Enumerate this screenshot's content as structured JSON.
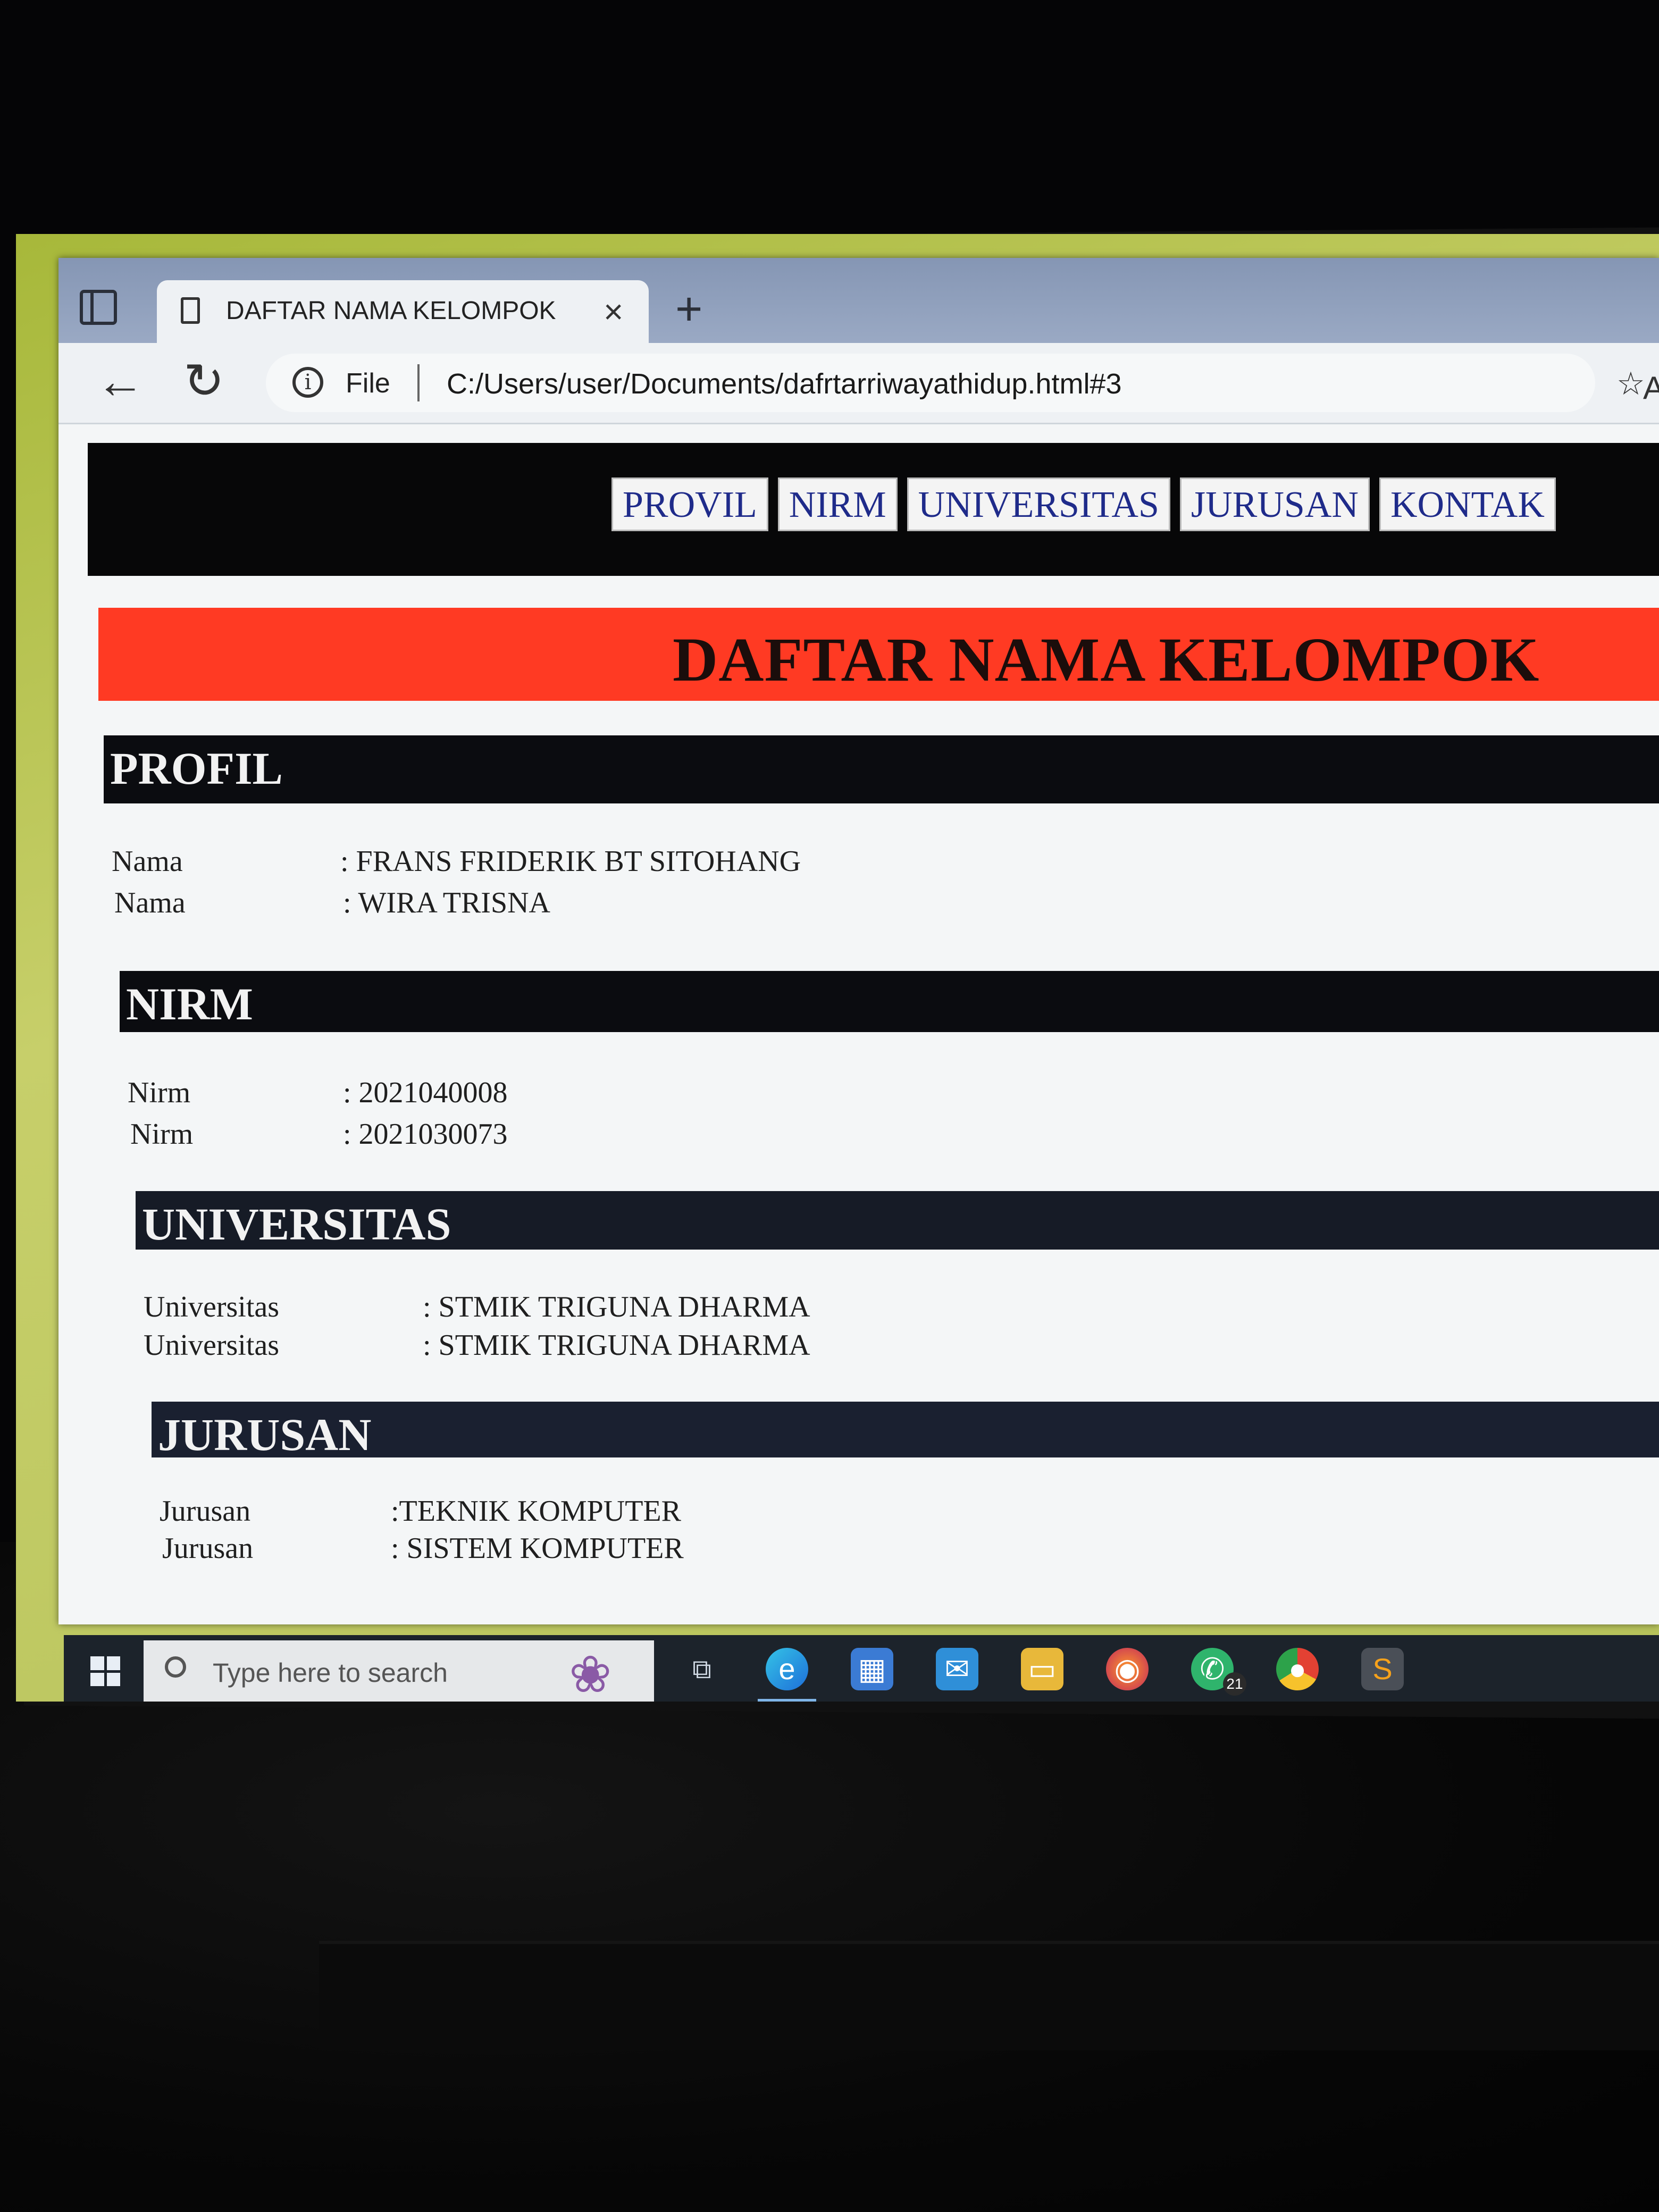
{
  "browser": {
    "tab_title": "DAFTAR NAMA KELOMPOK",
    "tab_close": "×",
    "new_tab": "+",
    "address": {
      "scheme_label": "File",
      "url": "C:/Users/user/Documents/dafrtarriwayathidup.html#3"
    },
    "icons": [
      "tab-actions-icon",
      "page-icon",
      "close-icon",
      "new-tab-icon",
      "back-icon",
      "reload-icon",
      "info-icon",
      "read-aloud-icon",
      "favorite-star-icon",
      "extensions-icon"
    ]
  },
  "page": {
    "nav": [
      "PROVIL",
      "NIRM",
      "UNIVERSITAS",
      "JURUSAN",
      "KONTAK"
    ],
    "banner_title": "DAFTAR NAMA KELOMPOK",
    "sections": [
      {
        "heading": "PROFIL",
        "rows": [
          {
            "label": "Nama",
            "value": ": FRANS FRIDERIK BT SITOHANG"
          },
          {
            "label": "Nama",
            "value": ": WIRA TRISNA"
          }
        ]
      },
      {
        "heading": "NIRM",
        "rows": [
          {
            "label": "Nirm",
            "value": ": 2021040008"
          },
          {
            "label": "Nirm",
            "value": ": 2021030073"
          }
        ]
      },
      {
        "heading": "UNIVERSITAS",
        "rows": [
          {
            "label": "Universitas",
            "value": ": STMIK TRIGUNA DHARMA"
          },
          {
            "label": "Universitas",
            "value": ": STMIK TRIGUNA DHARMA"
          }
        ]
      },
      {
        "heading": "JURUSAN",
        "rows": [
          {
            "label": "Jurusan",
            "value": ":TEKNIK KOMPUTER"
          },
          {
            "label": "Jurusan",
            "value": ": SISTEM KOMPUTER"
          }
        ]
      }
    ],
    "colors": {
      "nav_bg": "#070708",
      "nav_link": "#1f2b8a",
      "banner_bg": "#ff3a23",
      "section_bg": "#0b0c10"
    }
  },
  "taskbar": {
    "search_placeholder": "Type here to search",
    "whatsapp_badge": "21",
    "icons": [
      "windows-start-icon",
      "search-icon",
      "task-view-icon",
      "edge-icon",
      "store-icon",
      "mail-icon",
      "file-explorer-icon",
      "firefox-icon",
      "whatsapp-icon",
      "chrome-icon",
      "sublime-icon"
    ]
  }
}
